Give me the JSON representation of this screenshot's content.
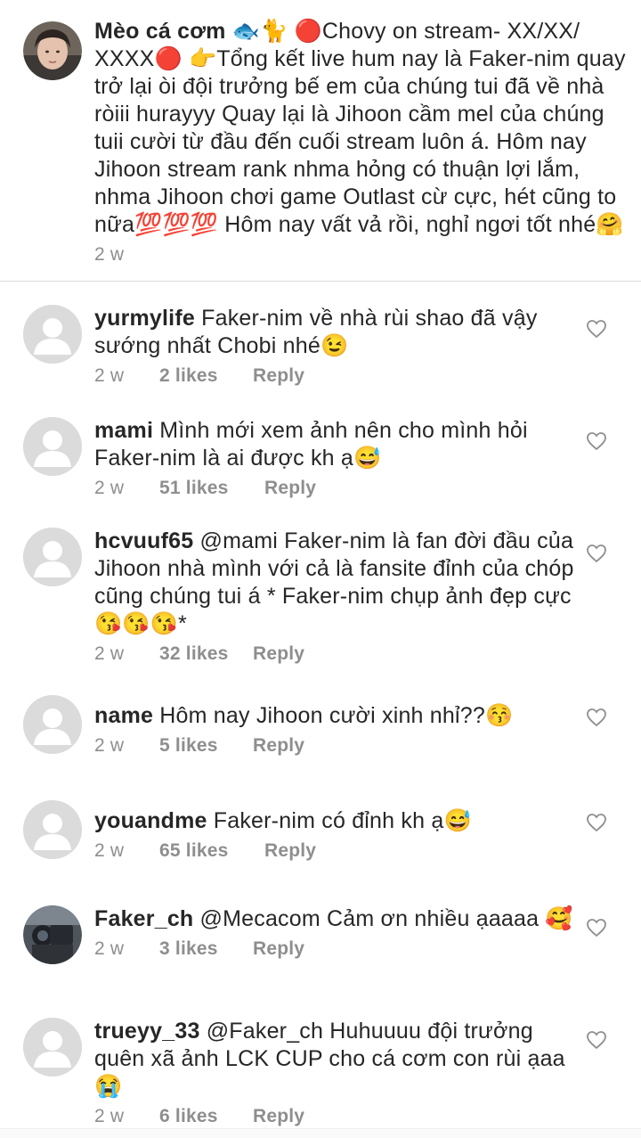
{
  "caption": {
    "username": "Mèo cá cơm",
    "text": "🐟🐈 🔴Chovy on stream- XX/XX/ XXXX🔴 👉Tổng kết live hum nay là Faker-nim quay trở lại òi đội trưởng bế em của chúng tui đã về nhà ròiii hurayyy Quay lại là Jihoon cầm mel của chúng tuii cười từ đầu đến cuối stream luôn á. Hôm nay Jihoon stream rank nhma hỏng có thuận lợi lắm, nhma Jihoon chơi game Outlast cừ cực, hét cũng to nữa💯💯💯 Hôm nay vất vả rồi, nghỉ ngơi tốt nhé🤗",
    "time": "2 w"
  },
  "comments": [
    {
      "username": "yurmylife",
      "text": "Faker-nim về nhà rùi shao đã vậy sướng nhất Chobi nhé😉",
      "time": "2 w",
      "likes": "2 likes",
      "reply": "Reply"
    },
    {
      "username": "mami",
      "text": "Mình mới xem ảnh nên cho mình hỏi Faker-nim là ai được kh ạ😅",
      "time": "2 w",
      "likes": "51 likes",
      "reply": "Reply"
    },
    {
      "username": "hcvuuf65",
      "text": "@mami Faker-nim là fan đời đầu của Jihoon nhà mình với cả là fansite đỉnh của chóp cũng chúng tui á * Faker-nim chụp ảnh đẹp cực😘😘😘*",
      "time": "2 w",
      "likes": "32 likes",
      "reply": "Reply"
    },
    {
      "username": "name",
      "text": "Hôm nay Jihoon cười xinh nhỉ??😚",
      "time": "2 w",
      "likes": "5 likes",
      "reply": "Reply"
    },
    {
      "username": "youandme",
      "text": "Faker-nim có đỉnh kh ạ😅",
      "time": "2 w",
      "likes": "65 likes",
      "reply": "Reply"
    },
    {
      "username": "Faker_ch",
      "text": "@Mecacom Cảm ơn nhiều ạaaaa 🥰",
      "time": "2 w",
      "likes": "3 likes",
      "reply": "Reply"
    },
    {
      "username": "trueyy_33",
      "text": "@Faker_ch Huhuuuu đội trưởng quên xã ảnh LCK CUP cho cá cơm con rùi ạaa😭",
      "time": "2 w",
      "likes": "6 likes",
      "reply": "Reply"
    }
  ]
}
